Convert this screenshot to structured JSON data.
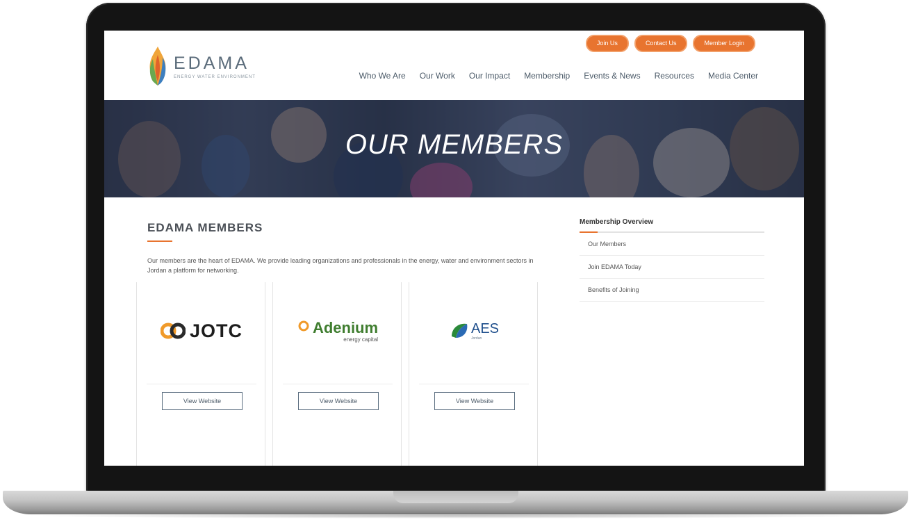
{
  "header": {
    "logo_text": "EDAMA",
    "logo_tagline": "ENERGY WATER ENVIRONMENT",
    "top_buttons": [
      "Join Us",
      "Contact Us",
      "Member Login"
    ],
    "nav": [
      "Who We Are",
      "Our Work",
      "Our Impact",
      "Membership",
      "Events & News",
      "Resources",
      "Media Center"
    ]
  },
  "hero": {
    "title": "OUR MEMBERS"
  },
  "content": {
    "heading": "EDAMA MEMBERS",
    "intro": "Our members are the heart of EDAMA. We provide leading organizations and professionals in the energy, water and environment sectors in Jordan a platform for networking.",
    "members": [
      {
        "logo_text": "JOTC",
        "button": "View Website"
      },
      {
        "logo_text": "Adenium",
        "logo_sub": "energy capital",
        "button": "View Website"
      },
      {
        "logo_text": "AES",
        "logo_sub": "Jordan",
        "button": "View Website"
      }
    ]
  },
  "sidebar": {
    "title": "Membership Overview",
    "items": [
      "Our Members",
      "Join EDAMA Today",
      "Benefits of Joining"
    ]
  },
  "colors": {
    "accent": "#e8742f",
    "nav_text": "#4b5a68",
    "hero_overlay": "#232d46"
  }
}
